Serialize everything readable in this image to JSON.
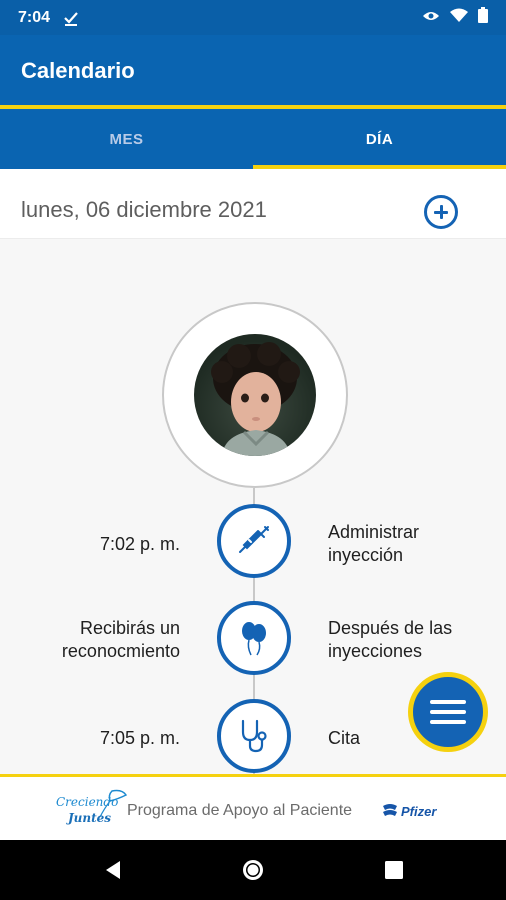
{
  "status_bar": {
    "time": "7:04"
  },
  "app_bar": {
    "title": "Calendario"
  },
  "tabs": [
    {
      "label": "MES",
      "selected": false
    },
    {
      "label": "DÍA",
      "selected": true
    }
  ],
  "day_view": {
    "date": "lunes, 06 diciembre 2021",
    "events": [
      {
        "left_text": "7:02 p. m.",
        "icon": "syringe-icon",
        "right_text": "Administrar inyección"
      },
      {
        "left_text": "Recibirás un reconocmiento",
        "icon": "balloons-icon",
        "right_text": "Después de las inyecciones"
      },
      {
        "left_text": "7:05 p. m.",
        "icon": "stethoscope-icon",
        "right_text": "Cita"
      }
    ]
  },
  "footer": {
    "logo_line1": "Creciendo",
    "logo_line2": "Juntes",
    "program_text": "Programa de Apoyo al Paciente",
    "brand": "Pfizer"
  },
  "colors": {
    "primary": "#0a64b1",
    "accent": "#f5d10f",
    "icon_blue": "#1463b4"
  }
}
